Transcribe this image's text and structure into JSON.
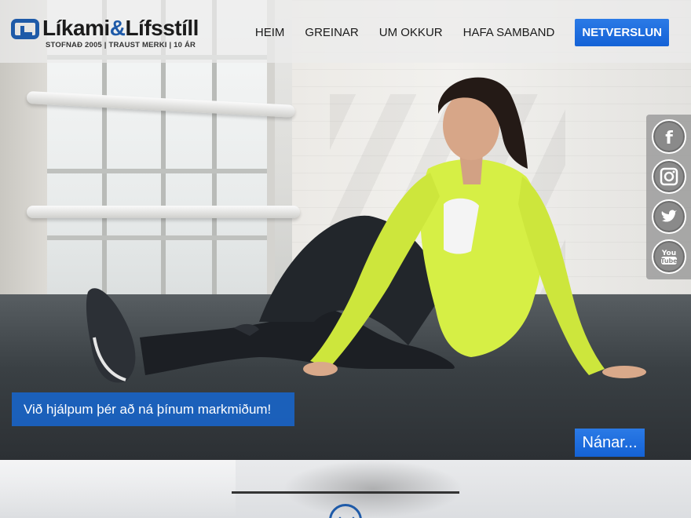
{
  "brand": {
    "name_part1": "Líkami",
    "name_amp": "&",
    "name_part2": "Lífsstíll",
    "tagline": "STOFNAÐ 2005 | TRAUST MERKI | 10 ÁR"
  },
  "nav": {
    "items": [
      {
        "label": "HEIM"
      },
      {
        "label": "GREINAR"
      },
      {
        "label": "UM OKKUR"
      },
      {
        "label": "HAFA SAMBAND"
      }
    ],
    "shop_label": "NETVERSLUN"
  },
  "social": {
    "icons": [
      "facebook-icon",
      "instagram-icon",
      "twitter-icon",
      "youtube-icon"
    ]
  },
  "hero": {
    "caption": "Við hjálpum þér að ná þínum markmiðum!",
    "more_label": "Nánar..."
  },
  "colors": {
    "accent": "#1e5aa8",
    "button": "#1462d6"
  }
}
